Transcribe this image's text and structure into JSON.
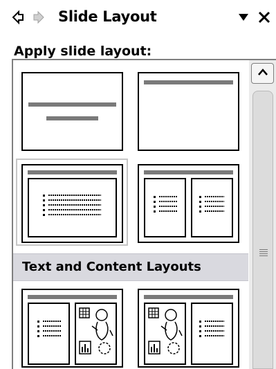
{
  "taskpane": {
    "title": "Slide Layout",
    "back_icon": "back-arrow-icon",
    "forward_icon": "forward-arrow-icon",
    "menu_icon": "dropdown-triangle-icon",
    "close_icon": "close-icon"
  },
  "apply_label": "Apply slide layout:",
  "section_header": "Text and Content Layouts",
  "layouts": [
    {
      "name": "Title Slide"
    },
    {
      "name": "Title Only"
    },
    {
      "name": "Title and Text",
      "selected": true
    },
    {
      "name": "Title and 2-Column Text"
    },
    {
      "name": "Title, Text, and Content"
    },
    {
      "name": "Title, Content and Text"
    }
  ],
  "scrollbar": {
    "up_icon": "chevron-up-icon"
  },
  "colors": {
    "placeholder_bar": "#7a7a7a",
    "section_bg": "#d9d9df"
  }
}
